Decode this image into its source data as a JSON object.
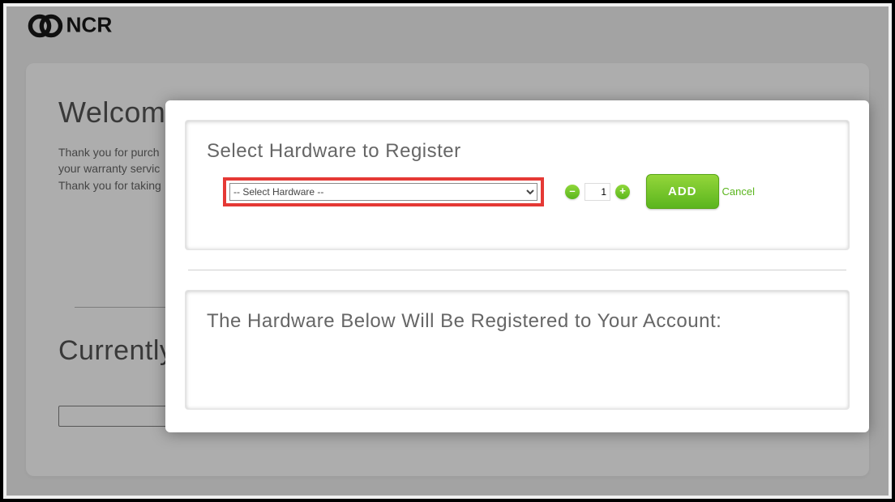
{
  "brand": {
    "name": "NCR"
  },
  "background": {
    "welcome_heading": "Welcome",
    "thanks_line_1": "Thank you for purch",
    "thanks_line_2": "your warranty servic",
    "thanks_line_3": "Thank you for taking",
    "currently_heading": "Currently"
  },
  "modal": {
    "select_panel": {
      "title": "Select Hardware to Register",
      "dropdown_placeholder": "-- Select Hardware --",
      "quantity_value": "1",
      "add_label": "ADD",
      "cancel_label": "Cancel"
    },
    "list_panel": {
      "title": "The Hardware Below Will Be Registered to Your Account:"
    }
  },
  "glyphs": {
    "minus": "–",
    "plus": "+"
  }
}
